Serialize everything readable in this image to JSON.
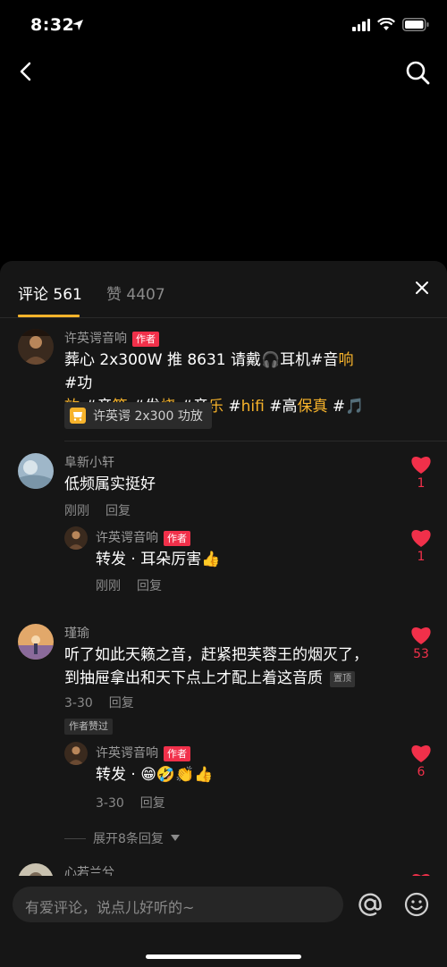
{
  "status": {
    "time": "8:32"
  },
  "sheet": {
    "tabs": {
      "comments": "评论 561",
      "likes": "赞 4407"
    }
  },
  "author_badge": "作者",
  "top_comment": {
    "name": "许英谔音响",
    "line1_a": "葬心 2x300W 推 8631 请戴🎧耳机#音",
    "line1_b": "响",
    "line1_c": " #功",
    "line2_a": "放",
    "line2_b": " #音",
    "line2_c": "箱",
    "line2_d": " #发",
    "line2_e": "烧",
    "line2_f": " #音",
    "line2_g": "乐",
    "line2_h": " #",
    "line2_i": "hifi",
    "line2_j": " #高",
    "line2_k": "保真",
    "line2_l": " #🎵",
    "product_label": "许英谔 2x300 功放"
  },
  "comments": [
    {
      "name": "阜新小轩",
      "text": "低频属实挺好",
      "time": "刚刚",
      "reply_label": "回复",
      "likes": "1",
      "reply": {
        "name": "许英谔音响",
        "text": "转发 · 耳朵厉害👍",
        "time": "刚刚",
        "reply_label": "回复",
        "likes": "1"
      }
    },
    {
      "name": "瑾瑜",
      "text_line1": "听了如此天籁之音，赶紧把芙蓉王的烟灭了，",
      "text_line2": "到抽屉拿出和天下点上才配上着这音质",
      "pin_tag": "置顶",
      "time": "3-30",
      "reply_label": "回复",
      "likes": "53",
      "author_liked": "作者赞过",
      "reply": {
        "name": "许英谔音响",
        "text": "转发 · 😁🤣👏👍",
        "time": "3-30",
        "reply_label": "回复",
        "likes": "6"
      },
      "expand_label": "展开8条回复"
    },
    {
      "name": "心若兰兮"
    }
  ],
  "input": {
    "placeholder": "有爱评论，说点儿好听的~"
  },
  "colors": {
    "accent": "#f7b32b",
    "like": "#f1304a",
    "sheet": "#161616",
    "badge": "#f1304a"
  }
}
